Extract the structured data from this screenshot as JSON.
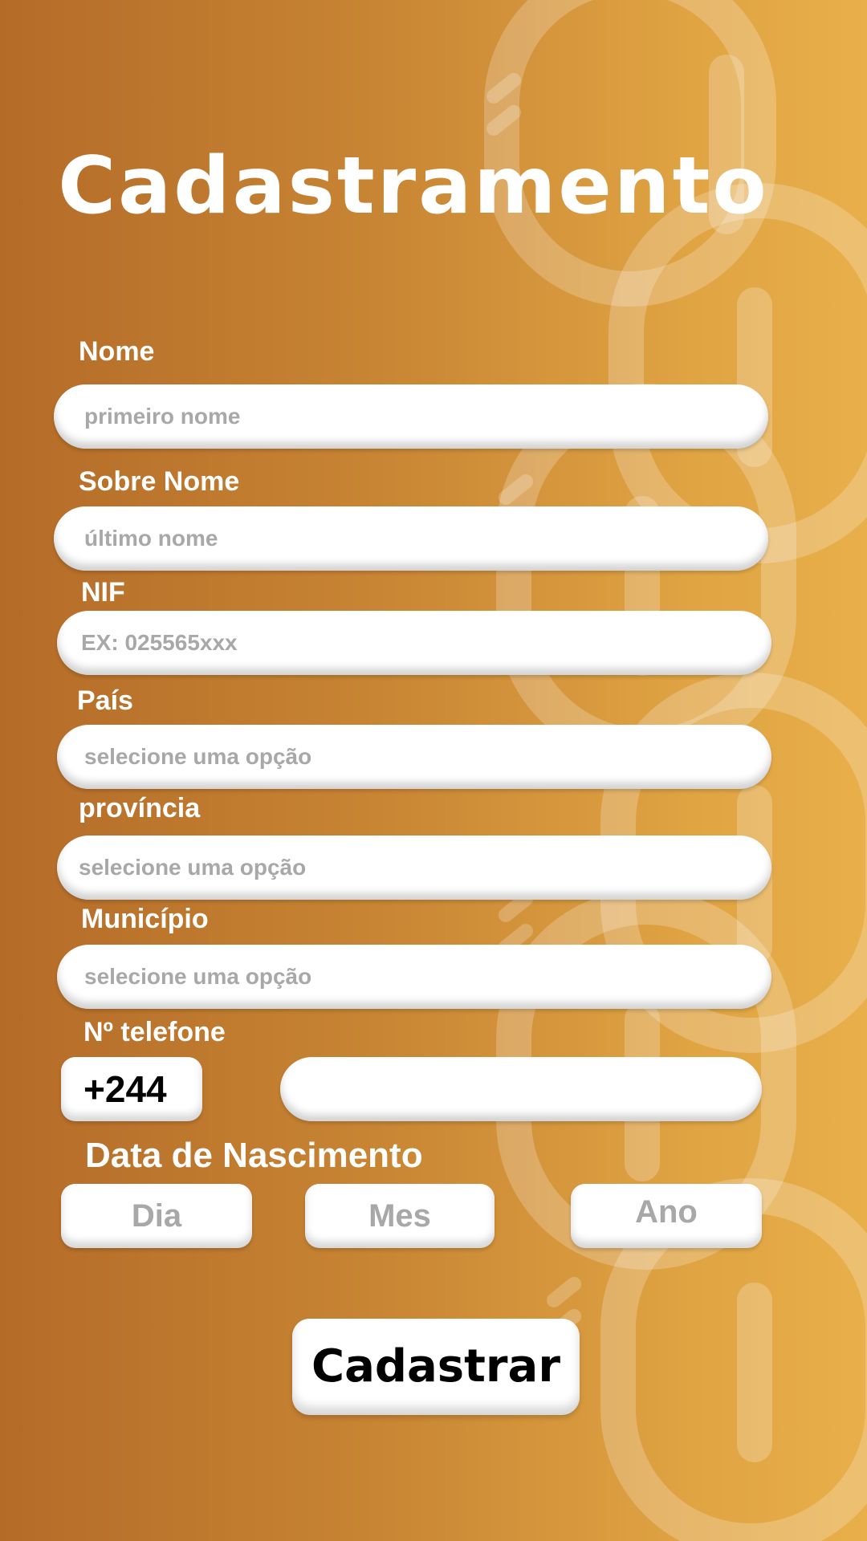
{
  "theme": {
    "gradient_start": "#b46b28",
    "gradient_end": "#e8af4a",
    "field_bg": "#ffffff",
    "placeholder_color": "#a8a8a8",
    "label_color": "#ffffff"
  },
  "title": "Cadastramento",
  "form": {
    "nome": {
      "label": "Nome",
      "placeholder": "primeiro nome"
    },
    "sobrenome": {
      "label": "Sobre Nome",
      "placeholder": "último nome"
    },
    "nif": {
      "label": "NIF",
      "placeholder": "EX: 025565xxx"
    },
    "pais": {
      "label": "País",
      "value": "selecione uma opção"
    },
    "provincia": {
      "label": "província",
      "value": "selecione uma opção"
    },
    "municipio": {
      "label": "Município",
      "value": "selecione uma opção"
    },
    "telefone": {
      "label": "Nº telefone",
      "prefix": "+244",
      "value": ""
    },
    "nascimento": {
      "label": "Data de Nascimento",
      "dia": "Dia",
      "mes": "Mes",
      "ano": "Ano"
    }
  },
  "submit_label": "Cadastrar",
  "background_icon": "chain-link-icon"
}
